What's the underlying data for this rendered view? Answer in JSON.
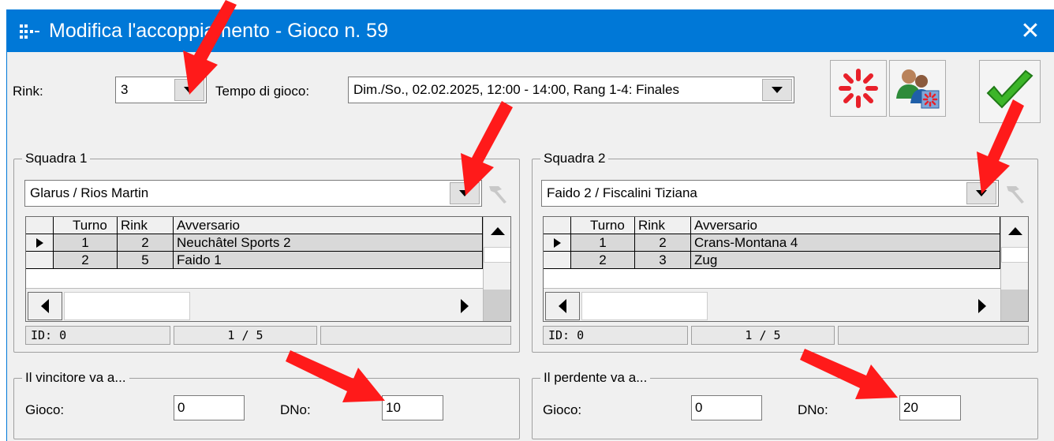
{
  "window": {
    "title": "Modifica l'accoppiamento - Gioco n. 59",
    "close_glyph": "✕",
    "accent": "#0078d7"
  },
  "top": {
    "rink_label": "Rink:",
    "rink_value": "3",
    "time_label": "Tempo di gioco:",
    "time_value": "Dim./So., 02.02.2025, 12:00 - 14:00, Rang 1-4: Finales"
  },
  "toolbar": {
    "icons": [
      "loading-spinner-icon",
      "team-swap-icon",
      "checkmark-icon"
    ]
  },
  "team1": {
    "group_label": "Squadra 1",
    "team_value": "Glarus / Rios Martin",
    "columns": [
      "Turno",
      "Rink",
      "Avversario"
    ],
    "rows": [
      {
        "turno": "1",
        "rink": "2",
        "avversario": "Neuchâtel Sports 2"
      },
      {
        "turno": "2",
        "rink": "5",
        "avversario": "Faido 1"
      }
    ],
    "status_id": "ID: 0",
    "status_page": "1 / 5"
  },
  "team2": {
    "group_label": "Squadra 2",
    "team_value": "Faido 2 / Fiscalini Tiziana",
    "columns": [
      "Turno",
      "Rink",
      "Avversario"
    ],
    "rows": [
      {
        "turno": "1",
        "rink": "2",
        "avversario": "Crans-Montana 4"
      },
      {
        "turno": "2",
        "rink": "3",
        "avversario": "Zug"
      }
    ],
    "status_id": "ID: 0",
    "status_page": "1 / 5"
  },
  "winner": {
    "group_label": "Il vincitore va a...",
    "game_label": "Gioco:",
    "game_value": "0",
    "dno_label": "DNo:",
    "dno_value": "10"
  },
  "loser": {
    "group_label": "Il perdente va a...",
    "game_label": "Gioco:",
    "game_value": "0",
    "dno_label": "DNo:",
    "dno_value": "20"
  },
  "annotation_color": "#ff1a1a"
}
